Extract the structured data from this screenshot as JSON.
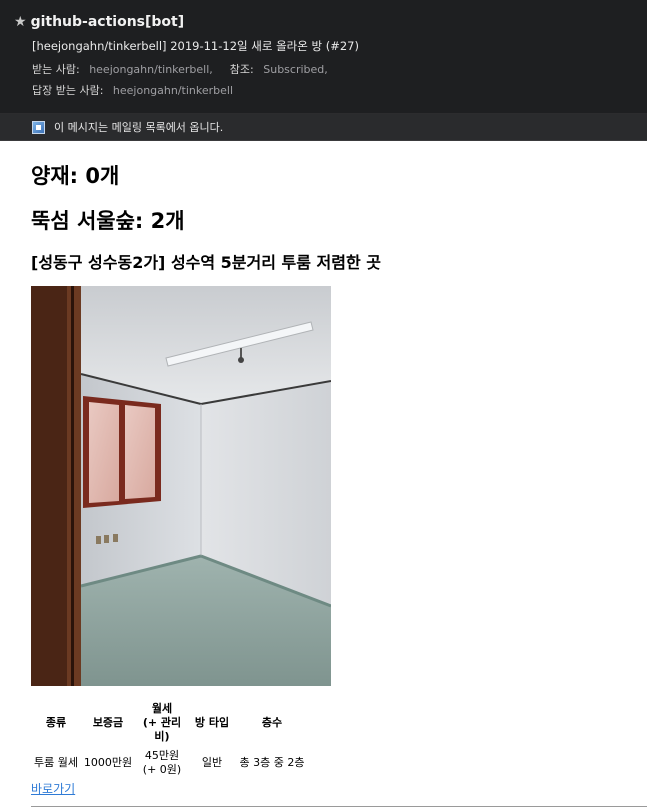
{
  "header": {
    "star_icon": "star-icon",
    "sender": "github-actions[bot]",
    "subject": "[heejongahn/tinkerbell] 2019-11-12일 새로 올라온 방 (#27)",
    "to_label": "받는 사람:",
    "to_value": "heejongahn/tinkerbell,",
    "cc_label": "참조:",
    "cc_value": "Subscribed,",
    "reply_label": "답장 받는 사람:",
    "reply_value": "heejongahn/tinkerbell"
  },
  "banner": {
    "icon": "mailing-list-icon",
    "text": "이 메시지는 메일링 목록에서 옵니다."
  },
  "content": {
    "yangjae": "양재: 0개",
    "ttukseom": "뚝섬 서울숲: 2개",
    "listing_title": "[성동구 성수동2가] 성수역 5분거리 투룸 저렴한 곳",
    "table": {
      "headers": [
        "종류",
        "보증금",
        "월세\n(+ 관리비)",
        "방 타입",
        "층수"
      ],
      "row": [
        "투룸 월세",
        "1000만원",
        "45만원\n(+ 0원)",
        "일반",
        "총 3층 중 2층"
      ]
    },
    "link_label": "바로가기"
  },
  "colors": {
    "header_bg": "#1e1f21",
    "banner_bg": "#2a2b2d",
    "link": "#2f7bd6"
  }
}
